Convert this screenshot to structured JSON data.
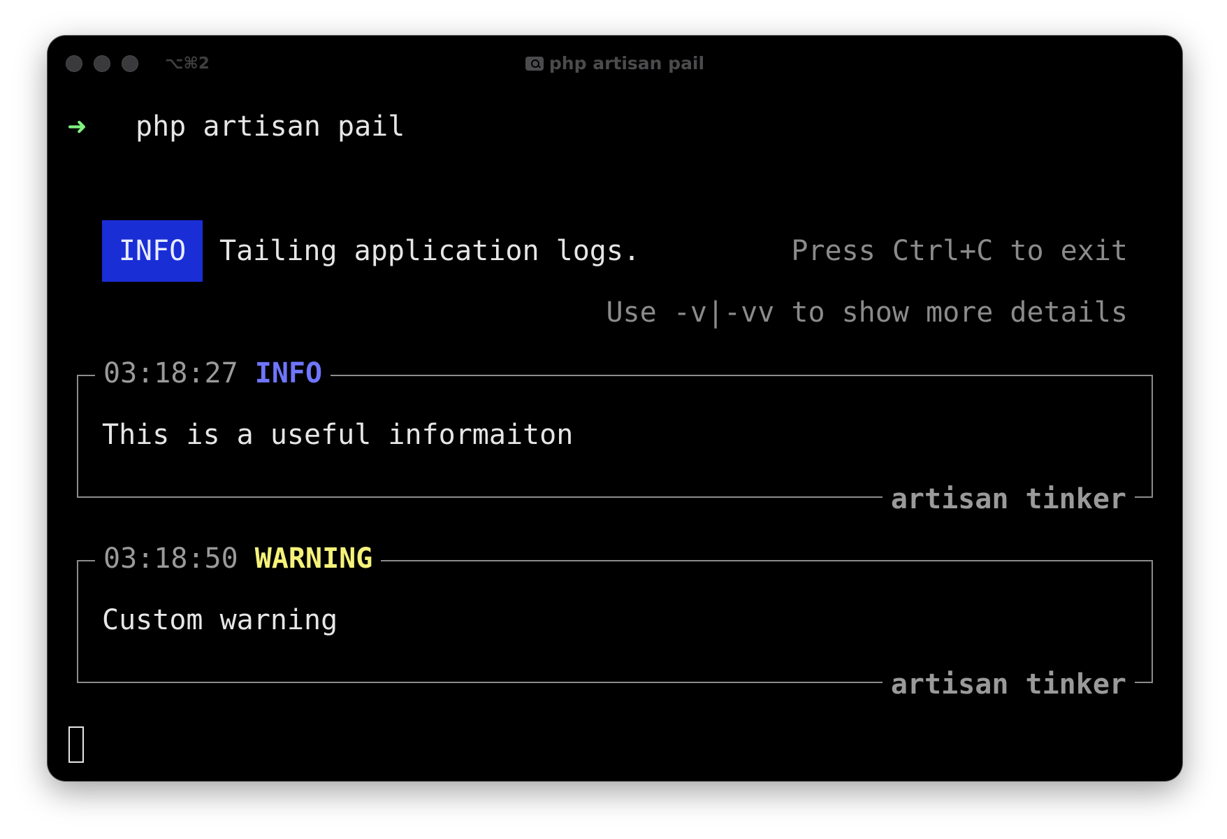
{
  "window": {
    "title": "php artisan pail",
    "shortcut": "⌥⌘2",
    "title_icon": "tab-search-icon"
  },
  "terminal": {
    "prompt_symbol": "➜",
    "command": "php artisan pail",
    "info_badge": "INFO",
    "tailing_text": "Tailing application logs.",
    "exit_hint": "Press Ctrl+C to exit",
    "details_hint": "Use -v|-vv to show more details",
    "logs": [
      {
        "time": "03:18:27",
        "level": "INFO",
        "message": "This is a useful informaiton",
        "origin": "artisan tinker"
      },
      {
        "time": "03:18:50",
        "level": "WARNING",
        "message": "Custom warning",
        "origin": "artisan tinker"
      }
    ]
  },
  "colors": {
    "background": "#000000",
    "prompt": "#7ff27f",
    "info_badge_bg": "#1a2ed6",
    "info_level": "#6f76ff",
    "warning_level": "#f4f27a",
    "muted_text": "#8b8b8b",
    "box_border": "#8c8c8c"
  }
}
